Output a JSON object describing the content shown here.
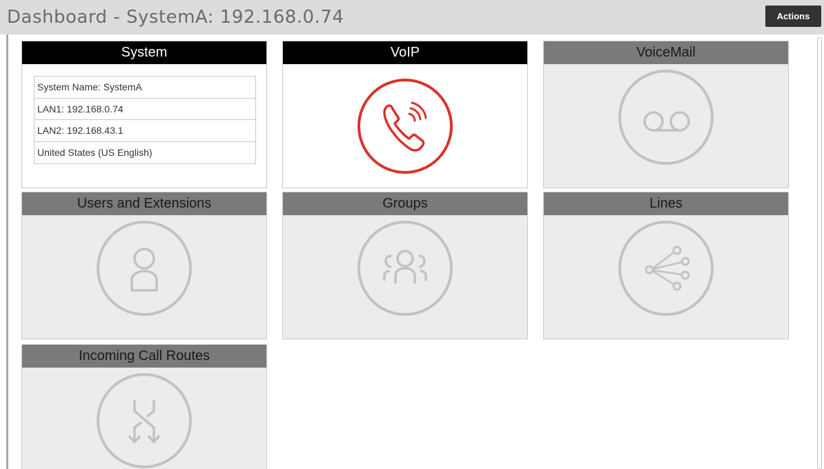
{
  "header": {
    "title": "Dashboard - SystemA: 192.168.0.74",
    "actions_label": "Actions"
  },
  "tiles": {
    "system": {
      "label": "System",
      "rows": [
        "System Name: SystemA",
        "LAN1: 192.168.0.74",
        "LAN2: 192.168.43.1",
        "United States (US English)"
      ]
    },
    "voip": {
      "label": "VoIP",
      "icon": "phone-icon"
    },
    "voicemail": {
      "label": "VoiceMail",
      "icon": "voicemail-icon"
    },
    "users": {
      "label": "Users and Extensions",
      "icon": "user-icon"
    },
    "groups": {
      "label": "Groups",
      "icon": "group-icon"
    },
    "lines": {
      "label": "Lines",
      "icon": "lines-icon"
    },
    "routes": {
      "label": "Incoming Call Routes",
      "icon": "call-routes-icon"
    }
  },
  "colors": {
    "active_header": "#000000",
    "inactive_header": "#7a7a7a",
    "voip_accent": "#d9322b",
    "inactive_icon": "#c2c2c2",
    "actions_button": "#333333"
  }
}
